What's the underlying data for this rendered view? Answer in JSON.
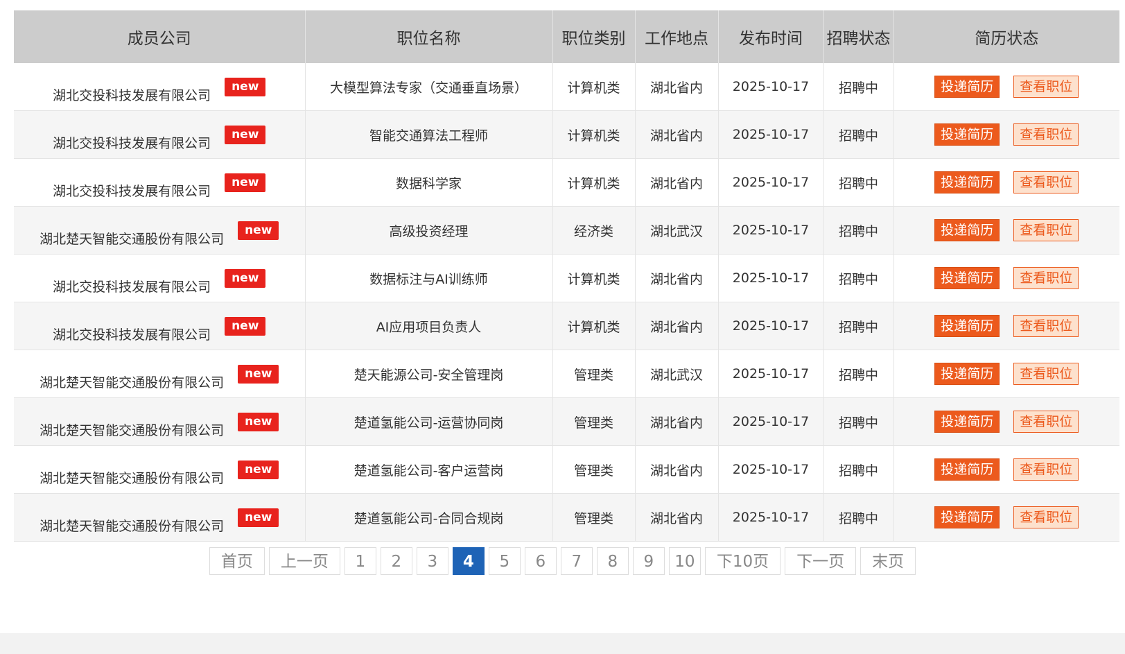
{
  "table": {
    "headers": [
      "成员公司",
      "职位名称",
      "职位类别",
      "工作地点",
      "发布时间",
      "招聘状态",
      "简历状态"
    ],
    "new_badge_label": "new",
    "apply_label": "投递简历",
    "view_label": "查看职位",
    "rows": [
      {
        "company": "湖北交投科技发展有限公司",
        "position": "大模型算法专家（交通垂直场景）",
        "category": "计算机类",
        "location": "湖北省内",
        "date": "2025-10-17",
        "status": "招聘中"
      },
      {
        "company": "湖北交投科技发展有限公司",
        "position": "智能交通算法工程师",
        "category": "计算机类",
        "location": "湖北省内",
        "date": "2025-10-17",
        "status": "招聘中"
      },
      {
        "company": "湖北交投科技发展有限公司",
        "position": "数据科学家",
        "category": "计算机类",
        "location": "湖北省内",
        "date": "2025-10-17",
        "status": "招聘中"
      },
      {
        "company": "湖北楚天智能交通股份有限公司",
        "position": "高级投资经理",
        "category": "经济类",
        "location": "湖北武汉",
        "date": "2025-10-17",
        "status": "招聘中"
      },
      {
        "company": "湖北交投科技发展有限公司",
        "position": "数据标注与AI训练师",
        "category": "计算机类",
        "location": "湖北省内",
        "date": "2025-10-17",
        "status": "招聘中"
      },
      {
        "company": "湖北交投科技发展有限公司",
        "position": "AI应用项目负责人",
        "category": "计算机类",
        "location": "湖北省内",
        "date": "2025-10-17",
        "status": "招聘中"
      },
      {
        "company": "湖北楚天智能交通股份有限公司",
        "position": "楚天能源公司-安全管理岗",
        "category": "管理类",
        "location": "湖北武汉",
        "date": "2025-10-17",
        "status": "招聘中"
      },
      {
        "company": "湖北楚天智能交通股份有限公司",
        "position": "楚道氢能公司-运营协同岗",
        "category": "管理类",
        "location": "湖北省内",
        "date": "2025-10-17",
        "status": "招聘中"
      },
      {
        "company": "湖北楚天智能交通股份有限公司",
        "position": "楚道氢能公司-客户运营岗",
        "category": "管理类",
        "location": "湖北省内",
        "date": "2025-10-17",
        "status": "招聘中"
      },
      {
        "company": "湖北楚天智能交通股份有限公司",
        "position": "楚道氢能公司-合同合规岗",
        "category": "管理类",
        "location": "湖北省内",
        "date": "2025-10-17",
        "status": "招聘中"
      }
    ]
  },
  "pagination": {
    "first": "首页",
    "prev": "上一页",
    "pages": [
      "1",
      "2",
      "3",
      "4",
      "5",
      "6",
      "7",
      "8",
      "9",
      "10"
    ],
    "current": "4",
    "next10": "下10页",
    "next": "下一页",
    "last": "末页"
  },
  "colors": {
    "header_bg": "#cccccc",
    "badge_red": "#e8231d",
    "apply_orange": "#ec5a1d",
    "view_bg": "#fde1cd",
    "active_page_blue": "#1e63b6"
  }
}
